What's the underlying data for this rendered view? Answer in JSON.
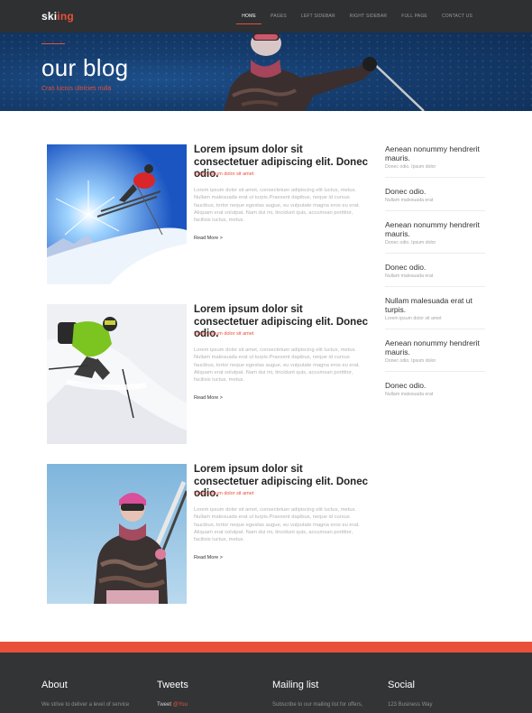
{
  "logo": {
    "part1": "ski",
    "part2": "ing"
  },
  "nav": [
    {
      "label": "HOME",
      "active": true
    },
    {
      "label": "PAGES",
      "active": false
    },
    {
      "label": "LEFT SIDEBAR",
      "active": false
    },
    {
      "label": "RIGHT SIDEBAR",
      "active": false
    },
    {
      "label": "FULL PAGE",
      "active": false
    },
    {
      "label": "CONTACT US",
      "active": false
    }
  ],
  "hero": {
    "title": "our blog",
    "subtitle": "Cras luctus ultricies nulla"
  },
  "posts": [
    {
      "title": "Lorem ipsum dolor sit consectetuer adipiscing elit. Donec odio.",
      "meta": "Lorem ipsum dolor sit amet",
      "body": "Lorem ipsum dolor sit amet, consectetuer adipiscing elit luctus, metus. Nullam malesuada erat ut turpis.Praesent dapibus, neque id cursus faucibus, tortor neque egestas augue, eu vulputate magna eros eu erat. Aliquam erat volutpat. Nam dui mi, tincidunt quis, accumsan porttitor, facilisis luctus, metus.",
      "more": "Read More >"
    },
    {
      "title": "Lorem ipsum dolor sit consectetuer adipiscing elit. Donec odio.",
      "meta": "Lorem ipsum dolor sit amet",
      "body": "Lorem ipsum dolor sit amet, consectetuer adipiscing elit luctus, metus. Nullam malesuada erat ut turpis.Praesent dapibus, neque id cursus faucibus, tortor neque egestas augue, eu vulputate magna eros eu erat. Aliquam erat volutpat. Nam dui mi, tincidunt quis, accumsan porttitor, facilisis luctus, metus.",
      "more": "Read More >"
    },
    {
      "title": "Lorem ipsum dolor sit consectetuer adipiscing elit. Donec odio.",
      "meta": "Lorem ipsum dolor sit amet",
      "body": "Lorem ipsum dolor sit amet, consectetuer adipiscing elit luctus, metus. Nullam malesuada erat ut turpis.Praesent dapibus, neque id cursus faucibus, tortor neque egestas augue, eu vulputate magna eros eu erat. Aliquam erat volutpat. Nam dui mi, tincidunt quis, accumsan porttitor, facilisis luctus, metus.",
      "more": "Read More >"
    }
  ],
  "sidebar": [
    {
      "title": "Aenean nonummy hendrerit mauris.",
      "sub": "Donec odio. Ipsum dolor"
    },
    {
      "title": "Donec odio.",
      "sub": "Nullam malesuada erat"
    },
    {
      "title": "Aenean nonummy hendrerit mauris.",
      "sub": "Donec odio. Ipsum dolor"
    },
    {
      "title": "Donec odio.",
      "sub": "Nullam malesuada erat"
    },
    {
      "title": "Nullam malesuada erat ut turpis.",
      "sub": "Lorem ipsum dolor sit amet"
    },
    {
      "title": "Aenean nonummy hendrerit mauris.",
      "sub": "Donec odio. Ipsum dolor"
    },
    {
      "title": "Donec odio.",
      "sub": "Nullam malesuada erat"
    }
  ],
  "footer": {
    "about": {
      "title": "About",
      "text": "We strive to deliver a level of service"
    },
    "tweets": {
      "title": "Tweets",
      "text_prefix": "Tweet",
      "text_accent": "@You"
    },
    "mailing": {
      "title": "Mailing list",
      "text": "Subscribe to our mailing list for offers,"
    },
    "social": {
      "title": "Social",
      "text": "123 Business Way"
    }
  },
  "colors": {
    "accent": "#e8503a",
    "nav_bg": "#2f3032",
    "hero_bg": "#153d6e",
    "footer_bg": "#333436"
  }
}
